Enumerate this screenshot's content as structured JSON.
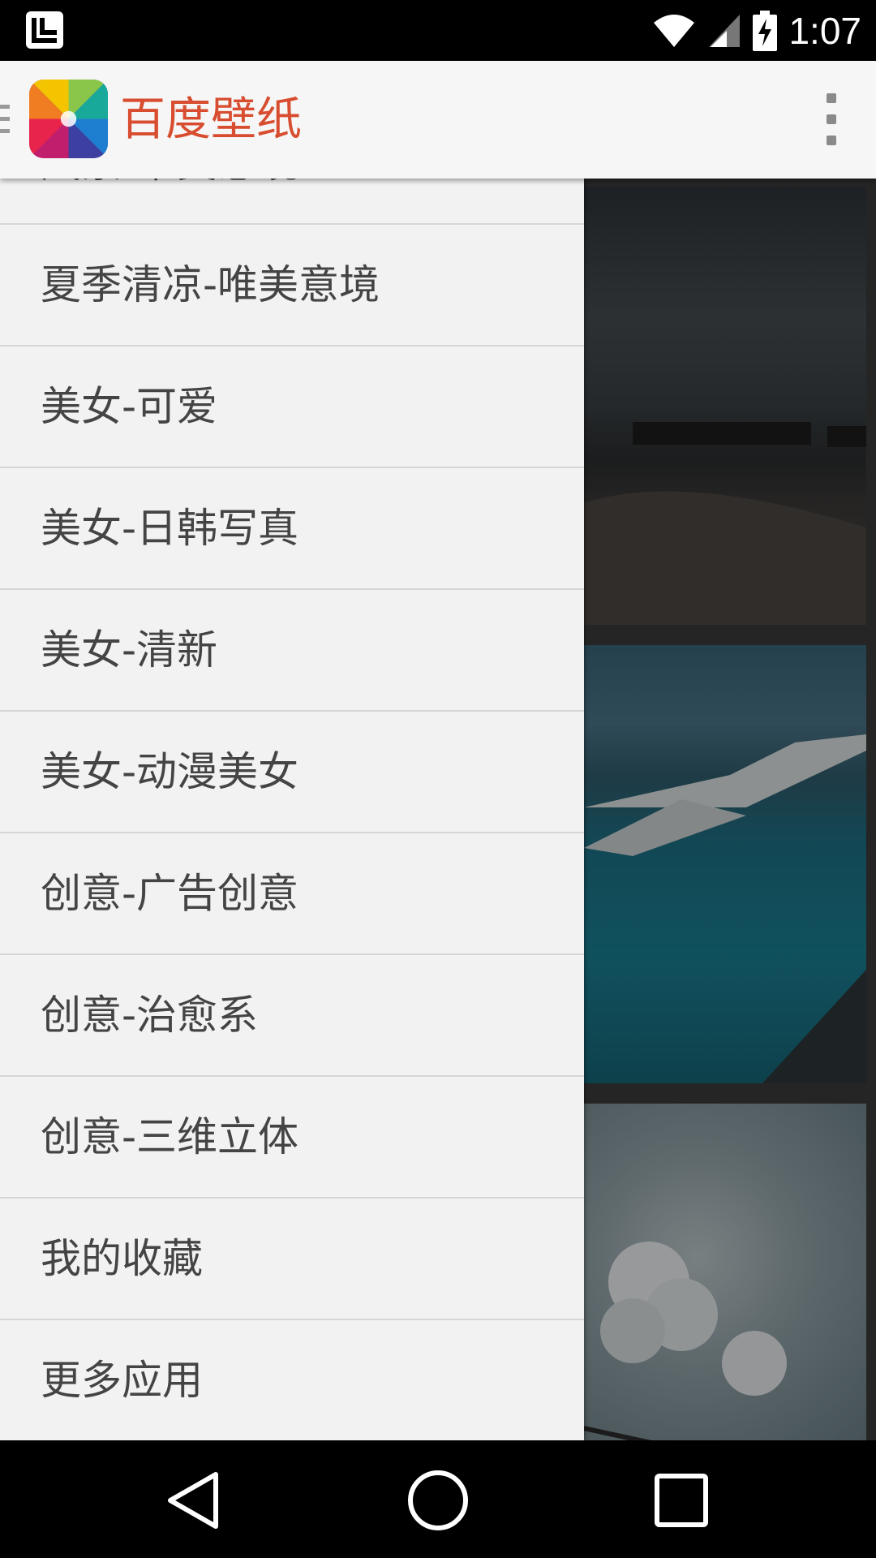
{
  "status_bar": {
    "time": "1:07",
    "icons": [
      "launcher-icon",
      "wifi-icon",
      "signal-icon",
      "battery-charging-icon"
    ]
  },
  "app_bar": {
    "title": "百度壁纸",
    "title_color": "#d84c2f",
    "icons": [
      "drawer-toggle-icon",
      "app-logo-icon",
      "overflow-menu-icon"
    ]
  },
  "drawer": {
    "items": [
      {
        "label": "风景-唯美意境"
      },
      {
        "label": "夏季清凉-唯美意境"
      },
      {
        "label": "美女-可爱"
      },
      {
        "label": "美女-日韩写真"
      },
      {
        "label": "美女-清新"
      },
      {
        "label": "美女-动漫美女"
      },
      {
        "label": "创意-广告创意"
      },
      {
        "label": "创意-治愈系"
      },
      {
        "label": "创意-三维立体"
      },
      {
        "label": "我的收藏"
      },
      {
        "label": "更多应用"
      }
    ]
  },
  "nav_bar": {
    "icons": [
      "back-icon",
      "home-icon",
      "recents-icon"
    ]
  }
}
